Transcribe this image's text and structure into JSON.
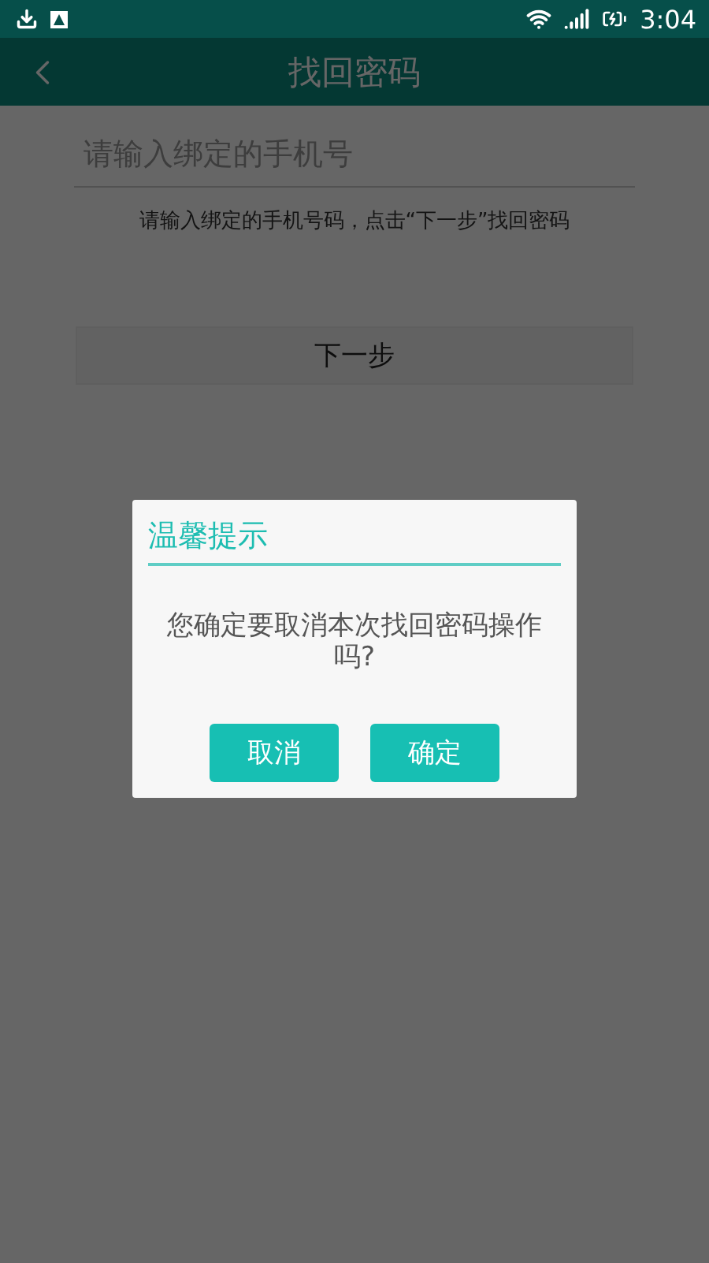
{
  "status_bar": {
    "time": "3:04"
  },
  "app_bar": {
    "title": "找回密码"
  },
  "phone_field": {
    "placeholder": "请输入绑定的手机号"
  },
  "hint": "请输入绑定的手机号码，点击“下一步”找回密码",
  "next_button": "下一步",
  "dialog": {
    "title": "温馨提示",
    "message": "您确定要取消本次找回密码操作吗?",
    "buttons": [
      "取消",
      "确定"
    ]
  }
}
